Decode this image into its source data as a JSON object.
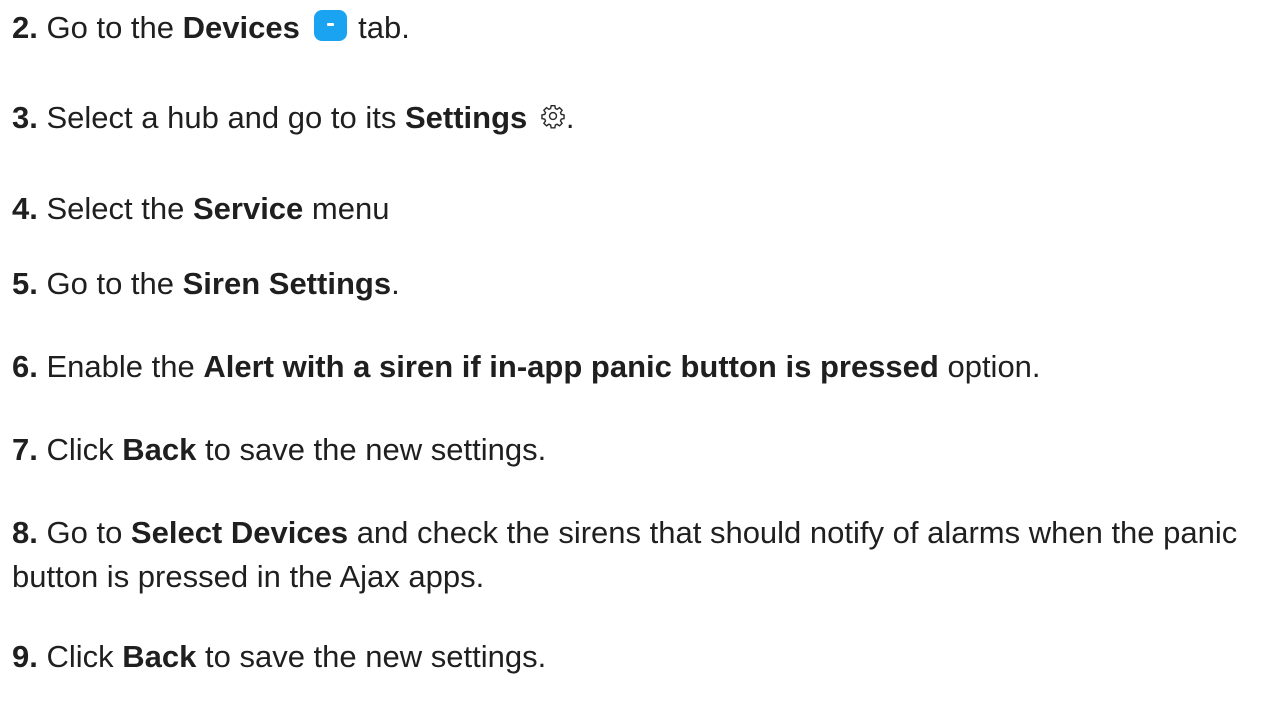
{
  "steps": [
    {
      "num": "2.",
      "pre": "Go to the ",
      "bold": "Devices",
      "icon": "devices-tab-icon",
      "post": " tab."
    },
    {
      "num": "3.",
      "pre": "Select a hub and go to its ",
      "bold": "Settings",
      "icon": "gear-icon",
      "post": "."
    },
    {
      "num": "4.",
      "pre": "Select the ",
      "bold": "Service",
      "post": " menu"
    },
    {
      "num": "5.",
      "pre": "Go to the ",
      "bold": "Siren Settings",
      "post": "."
    },
    {
      "num": "6.",
      "pre": "Enable the ",
      "bold": "Alert with a siren if in-app panic button is pressed",
      "post": " option."
    },
    {
      "num": "7.",
      "pre": "Click ",
      "bold": "Back",
      "post": " to save the new settings."
    },
    {
      "num": "8.",
      "pre": "Go to ",
      "bold": "Select Devices",
      "post": " and check the sirens that should notify of alarms when the panic button is pressed in the Ajax apps."
    },
    {
      "num": "9.",
      "pre": "Click ",
      "bold": "Back",
      "post": " to save the new settings."
    }
  ],
  "colors": {
    "text": "#1f1f1f",
    "devices_icon": "#1aa3f0"
  }
}
